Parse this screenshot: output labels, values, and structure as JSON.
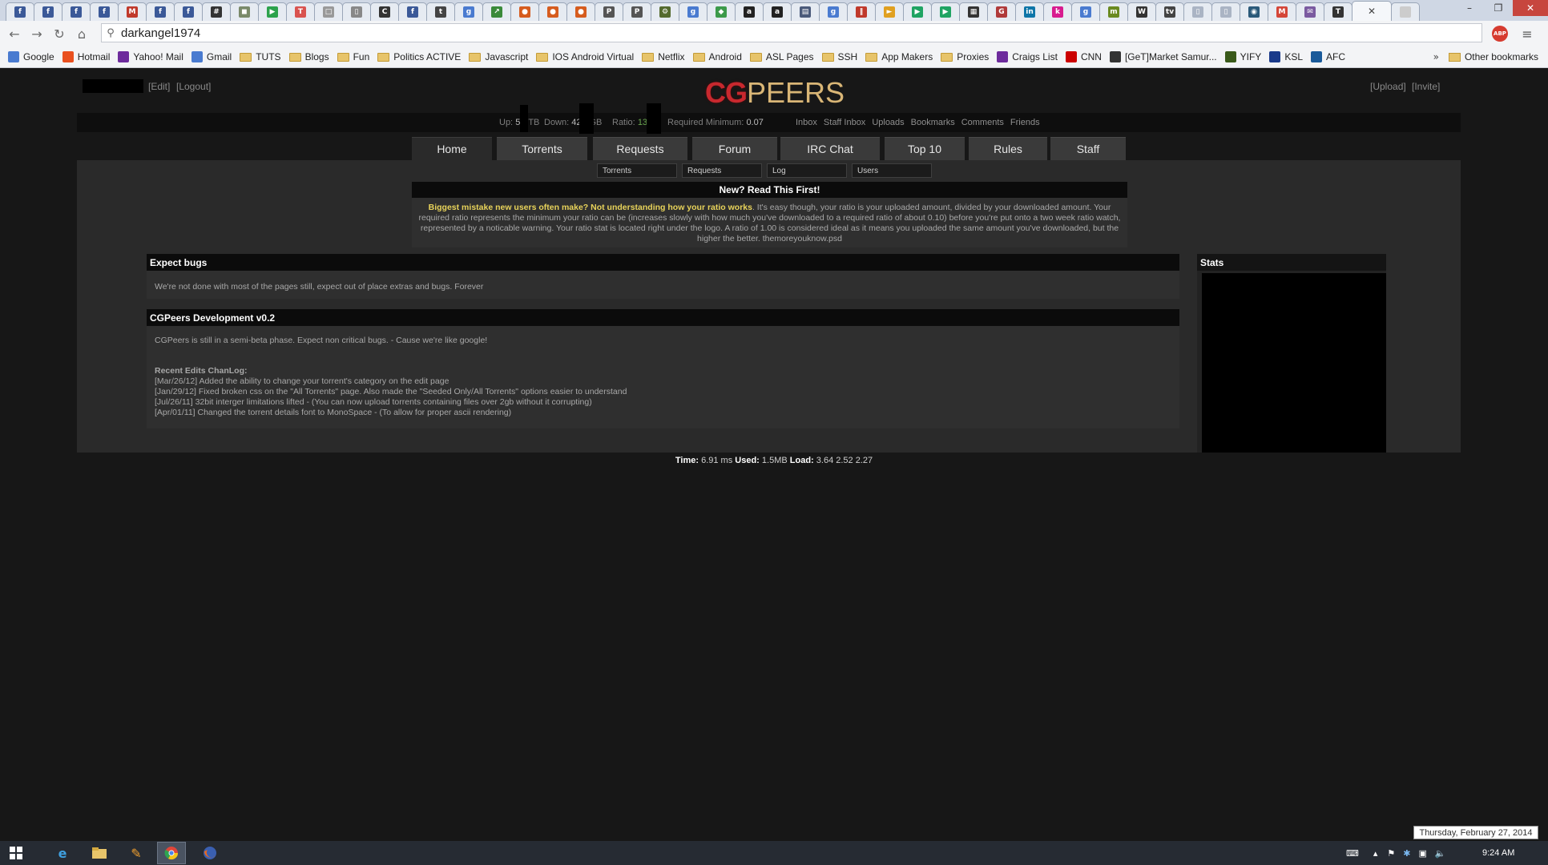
{
  "browser": {
    "tabs": [
      {
        "icon": "facebook-icon",
        "glyph": "f",
        "color": "#3b5998"
      },
      {
        "icon": "facebook-icon",
        "glyph": "f",
        "color": "#3b5998"
      },
      {
        "icon": "facebook-icon",
        "glyph": "f",
        "color": "#3b5998"
      },
      {
        "icon": "facebook-icon",
        "glyph": "f",
        "color": "#3b5998"
      },
      {
        "icon": "mail-icon",
        "glyph": "M",
        "color": "#c0392b"
      },
      {
        "icon": "facebook-icon",
        "glyph": "f",
        "color": "#3b5998"
      },
      {
        "icon": "facebook-icon",
        "glyph": "f",
        "color": "#3b5998"
      },
      {
        "icon": "grid-icon",
        "glyph": "#",
        "color": "#333333"
      },
      {
        "icon": "app-icon",
        "glyph": "◼",
        "color": "#7a8a6a"
      },
      {
        "icon": "play-icon",
        "glyph": "▶",
        "color": "#2ca24c"
      },
      {
        "icon": "tool-icon",
        "glyph": "T",
        "color": "#d9534f"
      },
      {
        "icon": "page-icon",
        "glyph": "□",
        "color": "#999999"
      },
      {
        "icon": "phone-icon",
        "glyph": "▯",
        "color": "#888888"
      },
      {
        "icon": "c-icon",
        "glyph": "C",
        "color": "#333333"
      },
      {
        "icon": "facebook-icon",
        "glyph": "f",
        "color": "#3b5998"
      },
      {
        "icon": "t-icon",
        "glyph": "t",
        "color": "#444444"
      },
      {
        "icon": "google-icon",
        "glyph": "g",
        "color": "#4a7bd0"
      },
      {
        "icon": "chart-icon",
        "glyph": "↗",
        "color": "#3a8a3a"
      },
      {
        "icon": "fox-icon",
        "glyph": "●",
        "color": "#d65c1e"
      },
      {
        "icon": "fox-icon",
        "glyph": "●",
        "color": "#d65c1e"
      },
      {
        "icon": "fox-icon",
        "glyph": "●",
        "color": "#d65c1e"
      },
      {
        "icon": "ipt-icon",
        "glyph": "P",
        "color": "#555555"
      },
      {
        "icon": "ipt-icon",
        "glyph": "P",
        "color": "#555555"
      },
      {
        "icon": "gear-icon",
        "glyph": "⚙",
        "color": "#556b2f"
      },
      {
        "icon": "google-icon",
        "glyph": "g",
        "color": "#4a7bd0"
      },
      {
        "icon": "leaf-icon",
        "glyph": "◆",
        "color": "#3c9a4a"
      },
      {
        "icon": "amazon-icon",
        "glyph": "a",
        "color": "#222222"
      },
      {
        "icon": "amazon-icon",
        "glyph": "a",
        "color": "#222222"
      },
      {
        "icon": "window-icon",
        "glyph": "▤",
        "color": "#4a5a7a"
      },
      {
        "icon": "google-icon",
        "glyph": "g",
        "color": "#4a7bd0"
      },
      {
        "icon": "bars-icon",
        "glyph": "‖",
        "color": "#c0392b"
      },
      {
        "icon": "arrow-icon",
        "glyph": "►",
        "color": "#e0a020"
      },
      {
        "icon": "play-store-icon",
        "glyph": "▶",
        "color": "#1fa463"
      },
      {
        "icon": "play-store-icon",
        "glyph": "▶",
        "color": "#1fa463"
      },
      {
        "icon": "qr-icon",
        "glyph": "▦",
        "color": "#333333"
      },
      {
        "icon": "gs-icon",
        "glyph": "G",
        "color": "#b03a3a"
      },
      {
        "icon": "linkedin-icon",
        "glyph": "in",
        "color": "#0e76a8"
      },
      {
        "icon": "k-icon",
        "glyph": "k",
        "color": "#d81b8f"
      },
      {
        "icon": "google-icon",
        "glyph": "g",
        "color": "#4a7bd0"
      },
      {
        "icon": "m-icon",
        "glyph": "m",
        "color": "#6a8a20"
      },
      {
        "icon": "tw-icon",
        "glyph": "W",
        "color": "#333333"
      },
      {
        "icon": "tvtv-icon",
        "glyph": "tv",
        "color": "#444444"
      },
      {
        "icon": "doc-icon",
        "glyph": "▯",
        "color": "#aab4c4"
      },
      {
        "icon": "doc-icon",
        "glyph": "▯",
        "color": "#aab4c4"
      },
      {
        "icon": "camera-icon",
        "glyph": "◉",
        "color": "#2b5a7a"
      },
      {
        "icon": "gmail-icon",
        "glyph": "M",
        "color": "#d44638"
      },
      {
        "icon": "envelope-icon",
        "glyph": "✉",
        "color": "#7a5aa0"
      },
      {
        "icon": "t-icon",
        "glyph": "T",
        "color": "#333333"
      },
      {
        "icon": "blank-icon",
        "glyph": "",
        "color": "#cccccc"
      }
    ],
    "url": "darkangel1974",
    "bookmarks": [
      {
        "label": "Google",
        "icon": "google-icon",
        "color": "#4a7bd0"
      },
      {
        "label": "Hotmail",
        "icon": "windows-icon",
        "color": "#e9501f"
      },
      {
        "label": "Yahoo! Mail",
        "icon": "envelope-icon",
        "color": "#6d2b9c"
      },
      {
        "label": "Gmail",
        "icon": "google-icon",
        "color": "#4a7bd0"
      },
      {
        "label": "TUTS",
        "icon": "folder-icon",
        "folder": true
      },
      {
        "label": "Blogs",
        "icon": "folder-icon",
        "folder": true
      },
      {
        "label": "Fun",
        "icon": "folder-icon",
        "folder": true
      },
      {
        "label": "Politics ACTIVE",
        "icon": "folder-icon",
        "folder": true
      },
      {
        "label": "Javascript",
        "icon": "folder-icon",
        "folder": true
      },
      {
        "label": "IOS Android Virtual",
        "icon": "folder-icon",
        "folder": true
      },
      {
        "label": "Netflix",
        "icon": "folder-icon",
        "folder": true
      },
      {
        "label": "Android",
        "icon": "folder-icon",
        "folder": true
      },
      {
        "label": "ASL Pages",
        "icon": "folder-icon",
        "folder": true
      },
      {
        "label": "SSH",
        "icon": "folder-icon",
        "folder": true
      },
      {
        "label": "App Makers",
        "icon": "folder-icon",
        "folder": true
      },
      {
        "label": "Proxies",
        "icon": "folder-icon",
        "folder": true
      },
      {
        "label": "Craigs List",
        "icon": "peace-icon",
        "color": "#6d2b9c"
      },
      {
        "label": "CNN",
        "icon": "cnn-icon",
        "color": "#cc0000"
      },
      {
        "label": "[GeT]Market Samur...",
        "icon": "samurai-icon",
        "color": "#333333"
      },
      {
        "label": "YIFY",
        "icon": "yify-icon",
        "color": "#3a5a1a"
      },
      {
        "label": "KSL",
        "icon": "ksl-icon",
        "color": "#1a3a8a"
      },
      {
        "label": "AFC",
        "icon": "afc-icon",
        "color": "#1a5a9a"
      }
    ],
    "bookmarks_overflow": "»",
    "other_bookmarks": "Other bookmarks"
  },
  "site": {
    "edit_link": "[Edit]",
    "logout_link": "[Logout]",
    "upload_link": "[Upload]",
    "invite_link": "[Invite]",
    "logo_cg": "CG",
    "logo_peers": "PEERS",
    "stats": {
      "up_label": "Up:",
      "up_value": "5",
      "up_unit": "TB",
      "down_label": "Down:",
      "down_value": "42",
      "down_unit": "GB",
      "ratio_label": "Ratio:",
      "ratio_value": "13",
      "required_label": "Required Minimum:",
      "required_value": "0.07"
    },
    "user_links": [
      "Inbox",
      "Staff Inbox",
      "Uploads",
      "Bookmarks",
      "Comments",
      "Friends"
    ],
    "nav": [
      "Home",
      "Torrents",
      "Requests",
      "Forum",
      "IRC Chat",
      "Top 10",
      "Rules",
      "Staff"
    ],
    "search_fields": [
      "Torrents",
      "Requests",
      "Log",
      "Users"
    ],
    "notice": {
      "title": "New? Read This First!",
      "highlight": "Biggest mistake new users often make? Not understanding how your ratio works",
      "text": ". It's easy though, your ratio is your uploaded amount, divided by your downloaded amount. Your required ratio represents the minimum your ratio can be (increases slowly with how much you've downloaded to a required ratio of about 0.10) before you're put onto a two week ratio watch, represented by a noticable warning. Your ratio stat is located right under the logo. A ratio of 1.00 is considered ideal as it means you uploaded the same amount you've downloaded, but the higher the better. themoreyouknow.psd"
    },
    "panel_bugs": {
      "title": "Expect bugs",
      "text": "We're not done with most of the pages still, expect out of place extras and bugs. Forever"
    },
    "panel_dev": {
      "title": "CGPeers Development v0.2",
      "text": "CGPeers is still in a semi-beta phase. Expect non critical bugs. - Cause we're like google!",
      "changelog_title": "Recent Edits ChanLog:",
      "changelog": [
        "[Mar/26/12] Added the ability to change your torrent's category on the edit page",
        "[Jan/29/12] Fixed broken css on the \"All Torrents\" page. Also made the \"Seeded Only/All Torrents\" options easier to understand",
        "[Jul/26/11]  32bit interger limitations lifted - (You can now upload torrents containing files over 2gb without it corrupting)",
        "[Apr/01/11] Changed the torrent details font to MonoSpace - (To allow for proper ascii rendering)"
      ]
    },
    "stats_panel_title": "Stats",
    "footer": {
      "time_label": "Time:",
      "time_value": "6.91 ms",
      "used_label": "Used:",
      "used_value": "1.5MB",
      "load_label": "Load:",
      "load_value": "3.64 2.52 2.27"
    }
  },
  "os": {
    "date_tooltip": "Thursday, February 27, 2014",
    "clock": "9:24 AM"
  }
}
